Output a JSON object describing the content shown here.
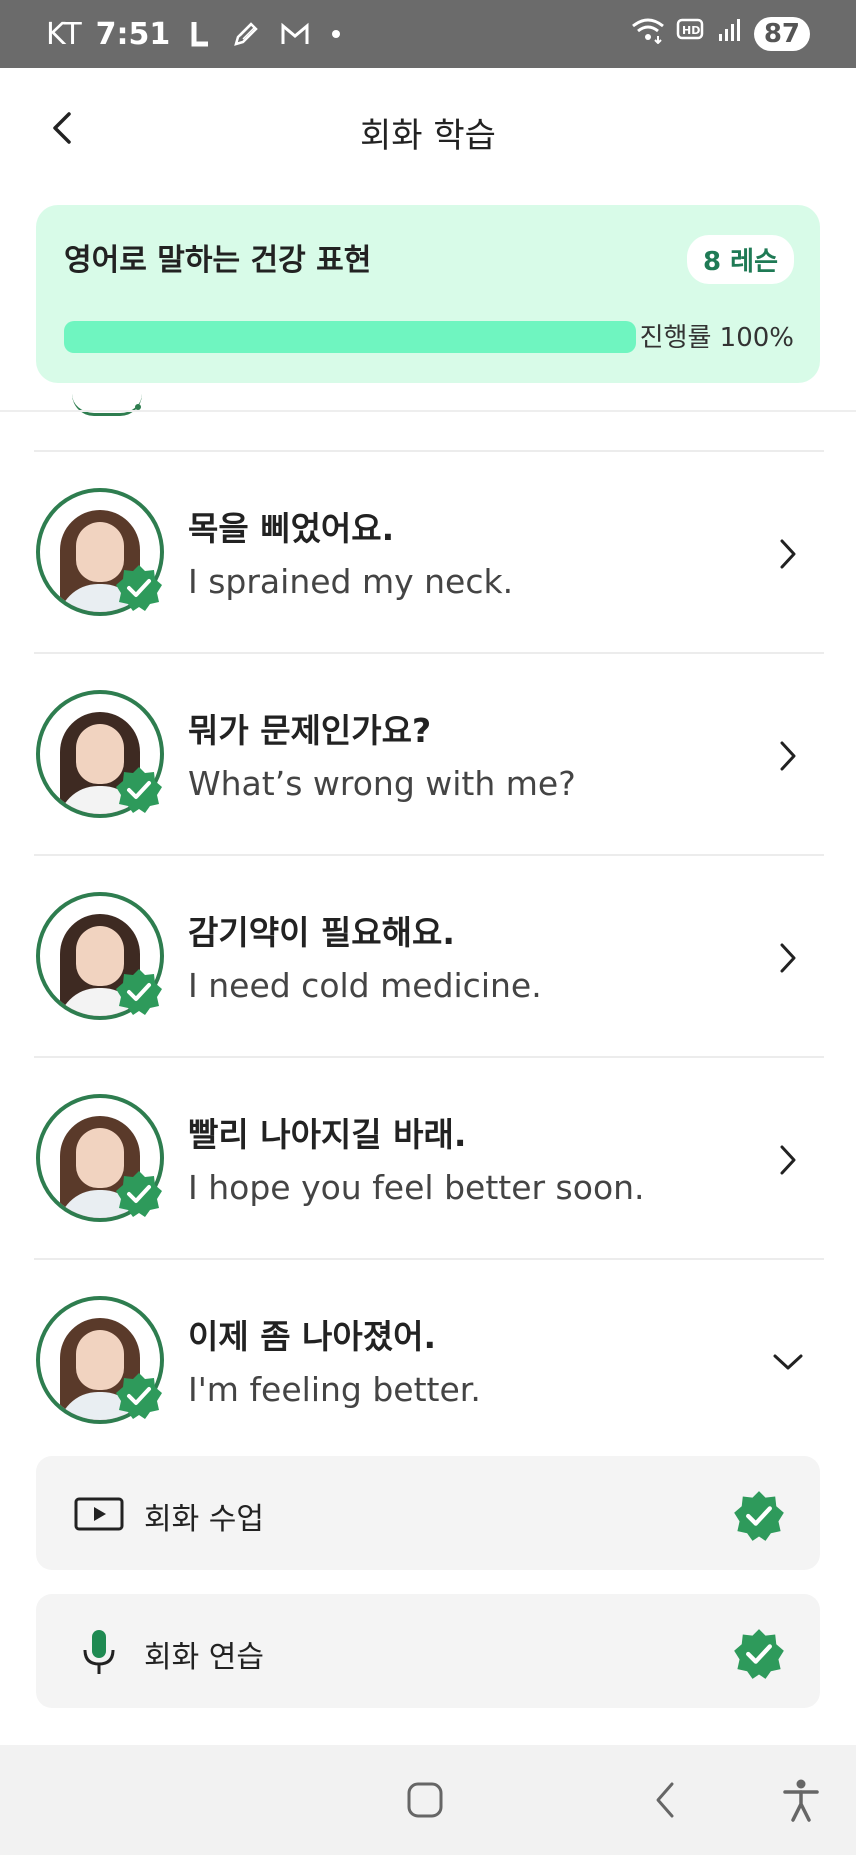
{
  "status_bar": {
    "carrier": "KT",
    "time": "7:51",
    "battery": "87",
    "icons": [
      "line-app-icon",
      "pen-icon",
      "gmail-icon",
      "dot-icon",
      "wifi-icon",
      "hd-icon",
      "signal-icon"
    ]
  },
  "header": {
    "title": "회화 학습",
    "back_icon": "chevron-left-icon"
  },
  "course": {
    "title": "영어로 말하는 건강 표현",
    "lesson_badge": "8 레슨",
    "progress_label": "진행률 100%",
    "progress_value": 1.0
  },
  "lessons": [
    {
      "ko": "목을 삐었어요.",
      "en": "I sprained my neck.",
      "completed": true,
      "expanded": false
    },
    {
      "ko": "뭐가 문제인가요?",
      "en": "What’s wrong with me?",
      "completed": true,
      "expanded": false
    },
    {
      "ko": "감기약이 필요해요.",
      "en": "I need cold medicine.",
      "completed": true,
      "expanded": false
    },
    {
      "ko": "빨리 나아지길 바래.",
      "en": "I hope you feel better soon.",
      "completed": true,
      "expanded": false
    },
    {
      "ko": "이제 좀 나아졌어.",
      "en": "I'm feeling better.",
      "completed": true,
      "expanded": true
    }
  ],
  "sub_items": [
    {
      "label": "회화 수업",
      "icon": "video-play-icon",
      "completed": true
    },
    {
      "label": "회화 연습",
      "icon": "microphone-icon",
      "completed": true
    }
  ],
  "nav_bar": {
    "icons": [
      "home-square-icon",
      "back-arrow-icon",
      "accessibility-icon"
    ]
  },
  "colors": {
    "status_bar": "#6b6b6b",
    "card_bg": "#d8fbe8",
    "progress": "#6ff5c0",
    "accent_green": "#2e7d4f",
    "badge_text": "#1f7a55",
    "sub_item_bg": "#f4f4f4"
  }
}
